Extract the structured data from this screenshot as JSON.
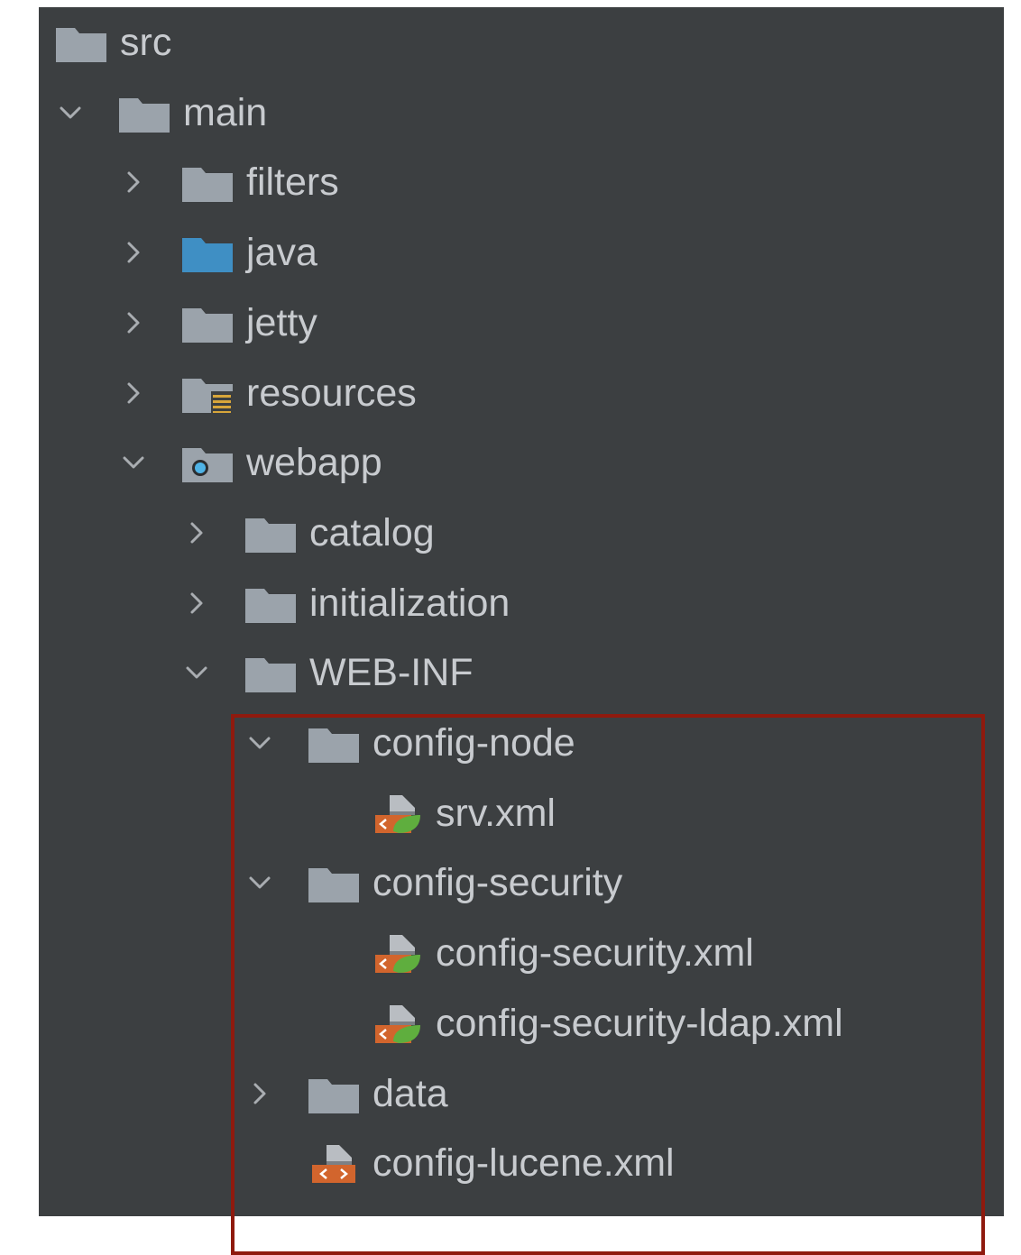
{
  "colors": {
    "panel_bg": "#3c3f41",
    "text": "#c8cbcf",
    "folder": "#9ba3ab",
    "source_folder": "#3f8fc4",
    "resource_marker": "#d8a63a",
    "xml_orange": "#d2652d",
    "spring_green": "#5fae3e",
    "highlight_border": "#8f1a0e"
  },
  "tree": {
    "items": [
      {
        "label": "src",
        "icon": "folder-icon",
        "expander": "none",
        "depth": 0
      },
      {
        "label": "main",
        "icon": "folder-icon",
        "expander": "expanded",
        "depth": 1
      },
      {
        "label": "filters",
        "icon": "folder-icon",
        "expander": "collapsed",
        "depth": 2
      },
      {
        "label": "java",
        "icon": "source-folder-icon",
        "expander": "collapsed",
        "depth": 2
      },
      {
        "label": "jetty",
        "icon": "folder-icon",
        "expander": "collapsed",
        "depth": 2
      },
      {
        "label": "resources",
        "icon": "resources-folder-icon",
        "expander": "collapsed",
        "depth": 2
      },
      {
        "label": "webapp",
        "icon": "web-folder-icon",
        "expander": "expanded",
        "depth": 2
      },
      {
        "label": "catalog",
        "icon": "folder-icon",
        "expander": "collapsed",
        "depth": 3
      },
      {
        "label": "initialization",
        "icon": "folder-icon",
        "expander": "collapsed",
        "depth": 3
      },
      {
        "label": "WEB-INF",
        "icon": "folder-icon",
        "expander": "expanded",
        "depth": 3
      },
      {
        "label": "config-node",
        "icon": "folder-icon",
        "expander": "expanded",
        "depth": 4
      },
      {
        "label": "srv.xml",
        "icon": "spring-xml-file-icon",
        "expander": "none",
        "depth": 5
      },
      {
        "label": "config-security",
        "icon": "folder-icon",
        "expander": "expanded",
        "depth": 4
      },
      {
        "label": "config-security.xml",
        "icon": "spring-xml-file-icon",
        "expander": "none",
        "depth": 5
      },
      {
        "label": "config-security-ldap.xml",
        "icon": "spring-xml-file-icon",
        "expander": "none",
        "depth": 5
      },
      {
        "label": "data",
        "icon": "folder-icon",
        "expander": "collapsed",
        "depth": 4
      },
      {
        "label": "config-lucene.xml",
        "icon": "xml-file-icon",
        "expander": "none",
        "depth": 4
      }
    ]
  }
}
